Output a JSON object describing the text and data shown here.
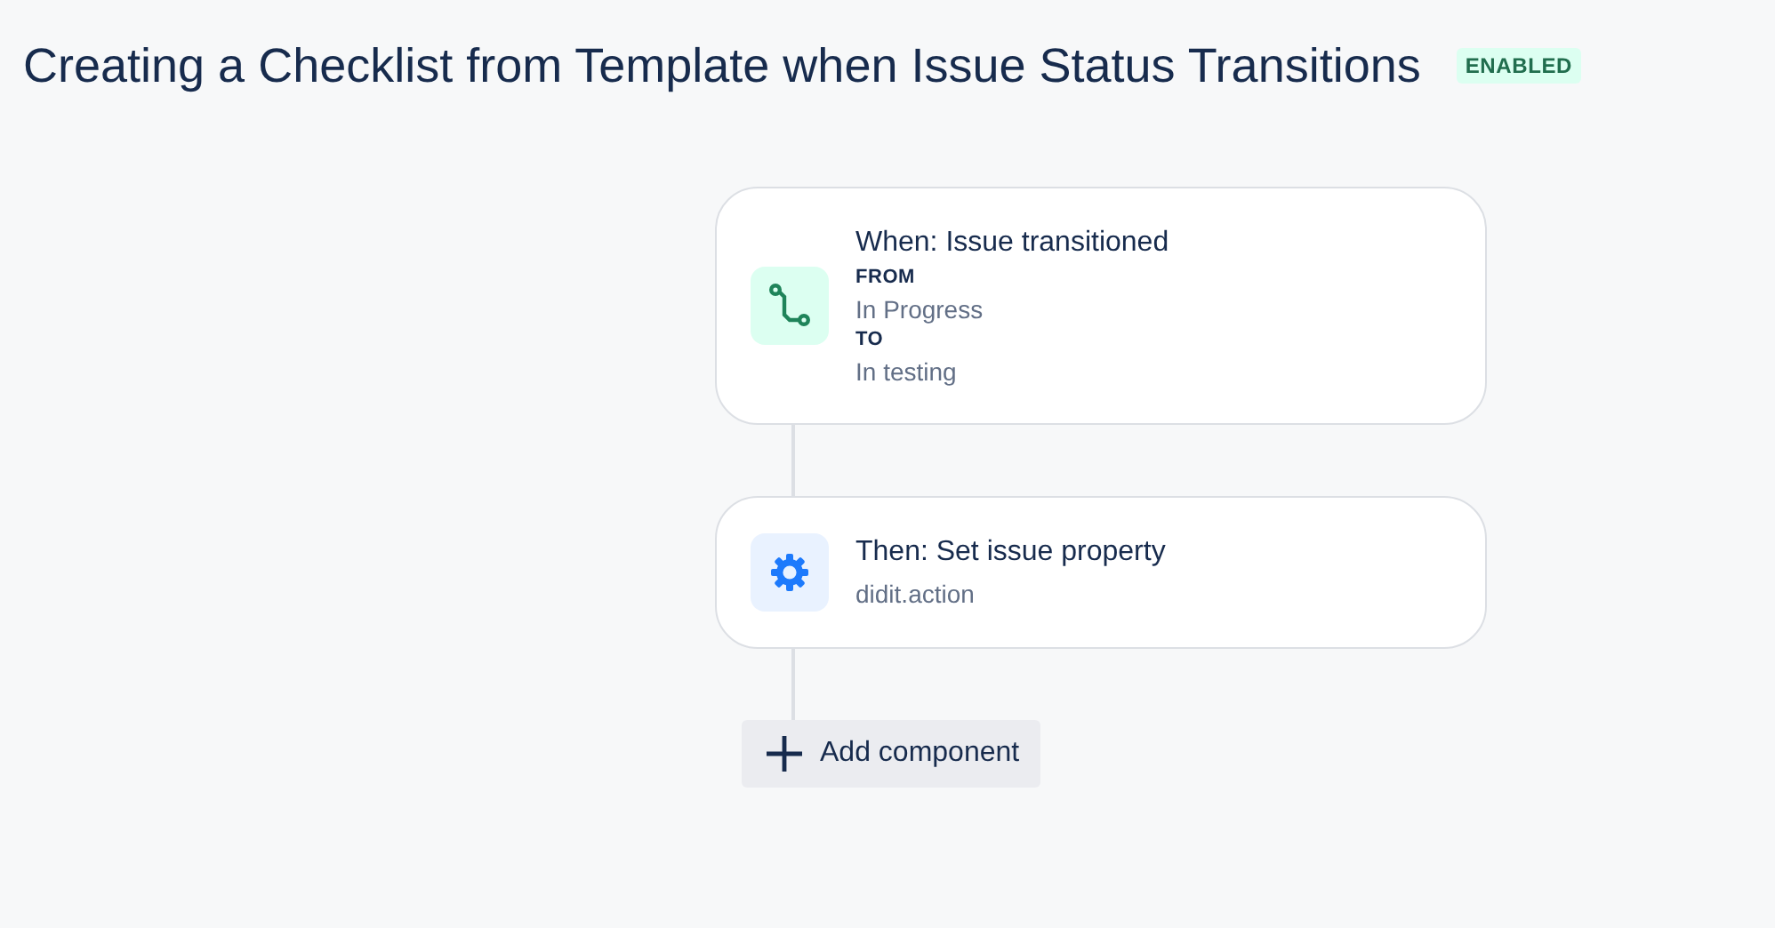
{
  "title": "Creating a Checklist from Template when Issue Status Transitions",
  "status_badge": "ENABLED",
  "components": [
    {
      "kind": "trigger",
      "title": "When: Issue transitioned",
      "details": [
        {
          "label": "FROM",
          "value": "In Progress"
        },
        {
          "label": "TO",
          "value": "In testing"
        }
      ]
    },
    {
      "kind": "action",
      "title": "Then: Set issue property",
      "subtitle": "didit.action"
    }
  ],
  "add_button": {
    "label": "Add component"
  }
}
